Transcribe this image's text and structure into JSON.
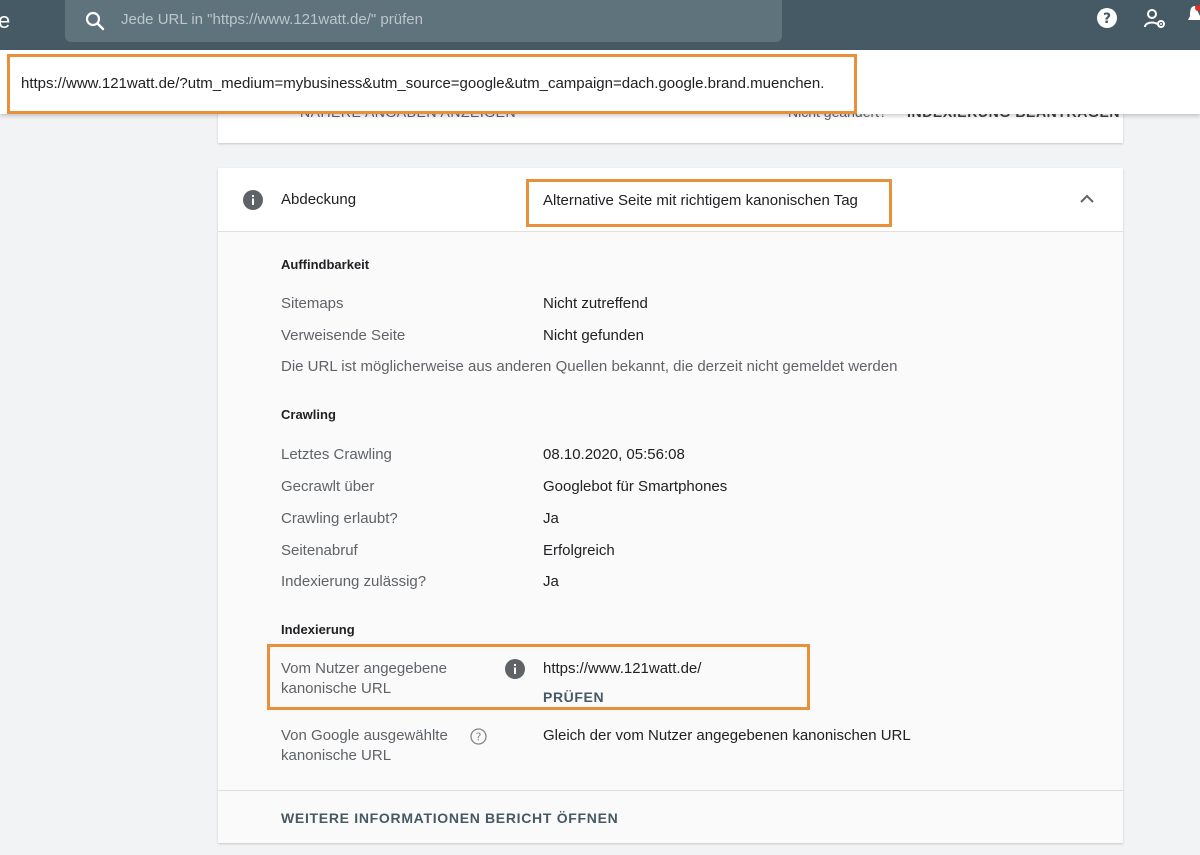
{
  "topbar": {
    "edge_letter": "e",
    "search": {
      "placeholder": "Jede URL in \"https://www.121watt.de/\" prüfen"
    },
    "icons": [
      "search-icon",
      "help-icon",
      "users-settings-icon",
      "bell-icon"
    ]
  },
  "url_banner": {
    "url": "https://www.121watt.de/?utm_medium=mybusiness&utm_source=google&utm_campaign=dach.google.brand.muenchen."
  },
  "top_card": {
    "partial_left": "NÄHERE ANGABEN ANZEIGEN",
    "partial_right_label": "Nicht geändert?",
    "partial_right_button": "INDEXIERUNG BEANTRAGEN"
  },
  "coverage": {
    "header_label": "Abdeckung",
    "header_value": "Alternative Seite mit richtigem kanonischen Tag",
    "sections": {
      "discoverability": {
        "title": "Auffindbarkeit",
        "rows": [
          {
            "label": "Sitemaps",
            "value": "Nicht zutreffend"
          },
          {
            "label": "Verweisende Seite",
            "value": "Nicht gefunden"
          }
        ],
        "note": "Die URL ist möglicherweise aus anderen Quellen bekannt, die derzeit nicht gemeldet werden"
      },
      "crawling": {
        "title": "Crawling",
        "rows": [
          {
            "label": "Letztes Crawling",
            "value": "08.10.2020, 05:56:08"
          },
          {
            "label": "Gecrawlt über",
            "value": "Googlebot für Smartphones"
          },
          {
            "label": "Crawling erlaubt?",
            "value": "Ja"
          },
          {
            "label": "Seitenabruf",
            "value": "Erfolgreich"
          },
          {
            "label": "Indexierung zulässig?",
            "value": "Ja"
          }
        ]
      },
      "indexing": {
        "title": "Indexierung",
        "user_canonical": {
          "label_line1": "Vom Nutzer angegebene",
          "label_line2": "kanonische URL",
          "value": "https://www.121watt.de/",
          "action": "PRÜFEN"
        },
        "google_canonical": {
          "label_line1": "Von Google ausgewählte",
          "label_line2": "kanonische URL",
          "value": "Gleich der vom Nutzer angegebenen kanonischen URL"
        }
      }
    },
    "footer": {
      "more_info": "WEITERE INFORMATIONEN",
      "open_report": "BERICHT ÖFFNEN"
    }
  },
  "colors": {
    "topbar": "#455a64",
    "highlight": "#e8913a",
    "link": "#455a64"
  }
}
